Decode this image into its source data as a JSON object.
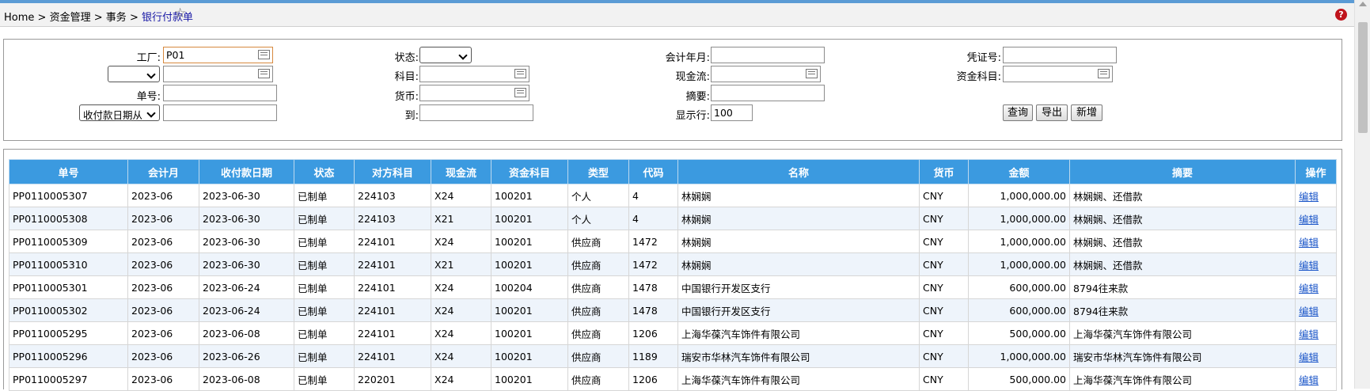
{
  "breadcrumb": [
    "Home",
    ">",
    "资金管理",
    ">",
    "事务",
    ">",
    "银行付款单"
  ],
  "help_icon": "?",
  "filters": {
    "factory_label": "工厂:",
    "factory_value": "P01",
    "status_label": "状态:",
    "period_label": "会计年月:",
    "voucher_label": "凭证号:",
    "subject_label": "科目:",
    "cashflow_label": "现金流:",
    "fund_subject_label": "资金科目:",
    "docno_label": "单号:",
    "currency_label": "货币:",
    "summary_label": "摘要:",
    "date_from_select": "收付款日期从",
    "to_label": "到:",
    "rows_label": "显示行:",
    "rows_value": "100",
    "query_btn": "查询",
    "export_btn": "导出",
    "new_btn": "新增"
  },
  "table": {
    "headers": [
      "单号",
      "会计月",
      "收付款日期",
      "状态",
      "对方科目",
      "现金流",
      "资金科目",
      "类型",
      "代码",
      "名称",
      "货币",
      "金额",
      "摘要",
      "操作"
    ],
    "rows": [
      [
        "PP0110005307",
        "2023-06",
        "2023-06-30",
        "已制单",
        "224103",
        "X24",
        "100201",
        "个人",
        "4",
        "林娴娴",
        "CNY",
        "1,000,000.00",
        "林娴娴、还借款",
        "编辑"
      ],
      [
        "PP0110005308",
        "2023-06",
        "2023-06-30",
        "已制单",
        "224103",
        "X21",
        "100201",
        "个人",
        "4",
        "林娴娴",
        "CNY",
        "1,000,000.00",
        "林娴娴、还借款",
        "编辑"
      ],
      [
        "PP0110005309",
        "2023-06",
        "2023-06-30",
        "已制单",
        "224101",
        "X24",
        "100201",
        "供应商",
        "1472",
        "林娴娴",
        "CNY",
        "1,000,000.00",
        "林娴娴、还借款",
        "编辑"
      ],
      [
        "PP0110005310",
        "2023-06",
        "2023-06-30",
        "已制单",
        "224101",
        "X21",
        "100201",
        "供应商",
        "1472",
        "林娴娴",
        "CNY",
        "1,000,000.00",
        "林娴娴、还借款",
        "编辑"
      ],
      [
        "PP0110005301",
        "2023-06",
        "2023-06-24",
        "已制单",
        "224101",
        "X24",
        "100204",
        "供应商",
        "1478",
        "中国银行开发区支行",
        "CNY",
        "600,000.00",
        "8794往来款",
        "编辑"
      ],
      [
        "PP0110005302",
        "2023-06",
        "2023-06-24",
        "已制单",
        "224101",
        "X24",
        "100201",
        "供应商",
        "1478",
        "中国银行开发区支行",
        "CNY",
        "600,000.00",
        "8794往来款",
        "编辑"
      ],
      [
        "PP0110005295",
        "2023-06",
        "2023-06-08",
        "已制单",
        "224101",
        "X24",
        "100201",
        "供应商",
        "1206",
        "上海华葆汽车饰件有限公司",
        "CNY",
        "500,000.00",
        "上海华葆汽车饰件有限公司",
        "编辑"
      ],
      [
        "PP0110005296",
        "2023-06",
        "2023-06-26",
        "已制单",
        "224101",
        "X24",
        "100201",
        "供应商",
        "1189",
        "瑞安市华林汽车饰件有限公司",
        "CNY",
        "1,000,000.00",
        "瑞安市华林汽车饰件有限公司",
        "编辑"
      ],
      [
        "PP0110005297",
        "2023-06",
        "2023-06-08",
        "已制单",
        "220201",
        "X24",
        "100201",
        "供应商",
        "1206",
        "上海华葆汽车饰件有限公司",
        "CNY",
        "500,000.00",
        "上海华葆汽车饰件有限公司",
        "编辑"
      ]
    ]
  }
}
